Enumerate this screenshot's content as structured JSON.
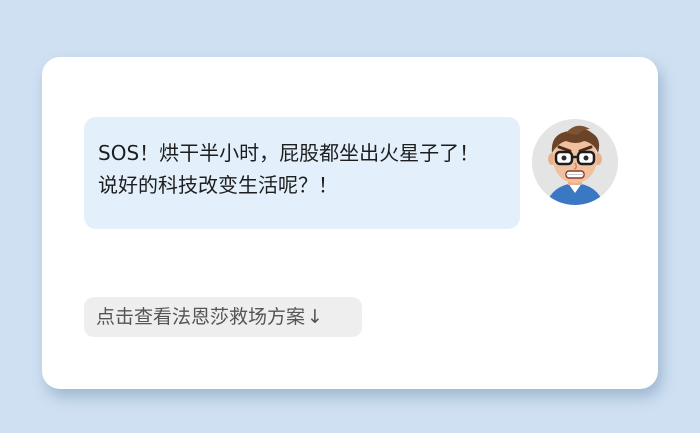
{
  "chat": {
    "message_lines": [
      "SOS！烘干半小时，屁股都坐出火星子了！",
      "说好的科技改变生活呢？！"
    ],
    "avatar_icon": "cartoon-man-glasses-avatar"
  },
  "action": {
    "label": "点击查看法恩莎救场方案",
    "arrow": "↓"
  },
  "colors": {
    "page_background": "#cfe0f2",
    "card_background": "#ffffff",
    "bubble_background": "#e3f0fb",
    "button_background": "#eeeeee"
  }
}
